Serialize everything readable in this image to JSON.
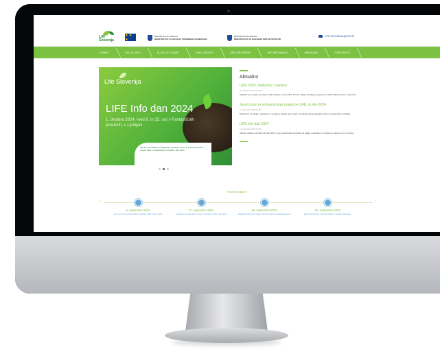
{
  "header": {
    "logo_text": "Life Slovenija",
    "eu_flag_stars": "★ ★ ★",
    "ministry1_line1": "REPUBLIKA SLOVENIJA",
    "ministry1_line2": "MINISTRSTVO ZA OKOLJE, PODNEBJE IN ENERGIJO",
    "ministry2_line1": "REPUBLIKA SLOVENIJA",
    "ministry2_line2": "MINISTRSTVO ZA NARAVNE VIRE IN PROSTOR",
    "contact_email": "LIFE.SLOVENIJA@GOV.SI"
  },
  "nav": {
    "items": [
      "DOMOV",
      "KAJ JE LIFE?",
      "ALI JE LIFE ZAME?",
      "KAKO ZAČETI?",
      "LIFE V SLOVENIJI",
      "VEČ INFORMACIJ",
      "AKTUALNO",
      "O PROJEKTU"
    ]
  },
  "banner": {
    "logo_text": "Life Slovenija",
    "title": "LIFE Info dan 2024",
    "subtitle": "1. oktobra 2024, med 9. in 15. uro v Fantastičnih prostorih, v Ljubljani",
    "card_text": "Vljudno ste vabljeni na dogodek, namenjen vsem, ki bi želeli pripraviti projekt LIFE in sodelovati pri razpisih v letu 2024."
  },
  "news": {
    "heading": "Aktualno",
    "items": [
      {
        "title": "LIFE 2024: Zaključek i razpisov",
        "date": "26. september 2024 | 9:00",
        "text": "Zaključil se je razpis za prijavo LIFE projektov v letu 2024. Rok za oddajo predlogov projektov za LIFE 2024 je bil 19. september."
      },
      {
        "title": "Javni poziv za sofinanciranje projektov LIFE za leto 2024",
        "date": "5. september 2024 | 9:00",
        "text": "Ministrstvo za okolje, podnebje in energijo je objavilo javni poziv za sofinanciranje projektov LIFE v programskem obdobju."
      },
      {
        "title": "LIFE Info dan 2024",
        "date": "2. september 2024 | 9:00",
        "text": "Vljudno vabljeni na LIFE Info dan 2024, ki ga organizirata ministrstvi za okolje, podnebje in energijo ter naravne vire in prostor."
      }
    ]
  },
  "timeline": {
    "title": "Pomembni datumi",
    "items": [
      {
        "date": "5. september 2024",
        "text": "Javni poziv za sofinanciranje projektov LIFE za leto 2024"
      },
      {
        "date": "17. september 2024",
        "text": "Evropska komisija objavi razpis za projekte LIFE v letu 2024"
      },
      {
        "date": "19. september 2024",
        "text": "Zaključek razpisa za prijavo LIFE projektov standardnega tipa"
      },
      {
        "date": "19. september 2024",
        "text": "Evropska komisija ocenjuje prijave in obvesti prijavitelje"
      }
    ]
  },
  "colors": {
    "accent_green": "#7cc242",
    "blue": "#64a8d8"
  }
}
